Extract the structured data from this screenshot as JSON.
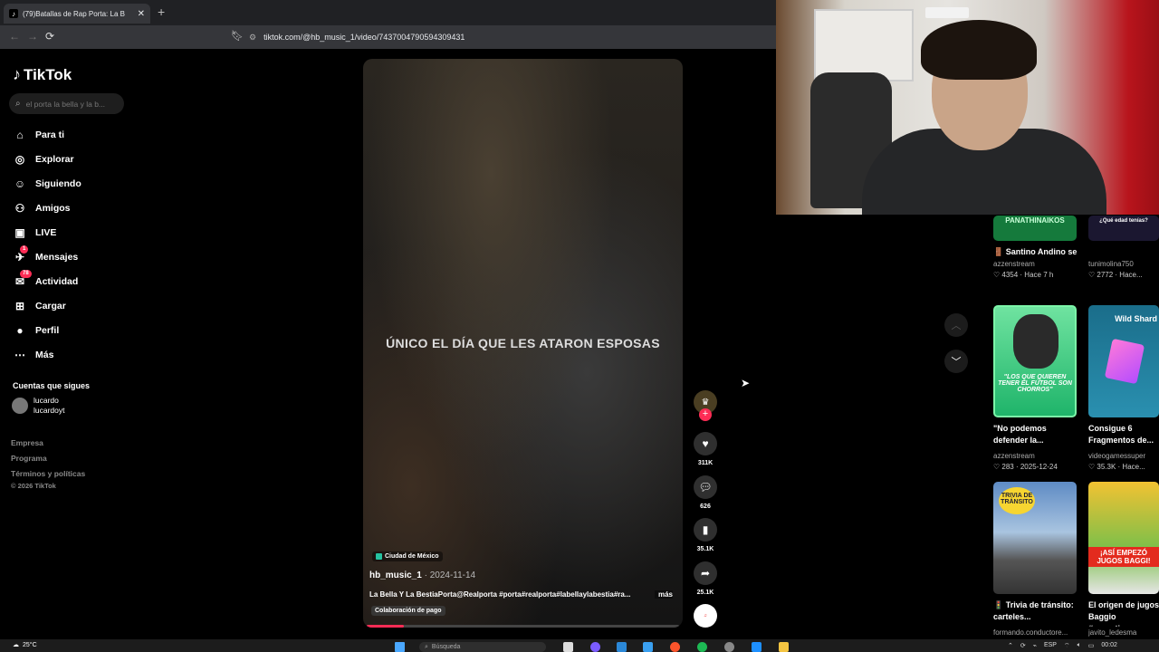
{
  "browser": {
    "tab_title": "(79)Batallas de Rap Porta: La B",
    "url": "tiktok.com/@hb_music_1/video/7437004790594309431"
  },
  "sidebar": {
    "logo": "TikTok",
    "search_placeholder": "el porta la bella y la b...",
    "nav": [
      {
        "label": "Para ti",
        "icon": "home-icon"
      },
      {
        "label": "Explorar",
        "icon": "compass-icon"
      },
      {
        "label": "Siguiendo",
        "icon": "following-icon"
      },
      {
        "label": "Amigos",
        "icon": "friends-icon"
      },
      {
        "label": "LIVE",
        "icon": "live-icon"
      },
      {
        "label": "Mensajes",
        "icon": "messages-icon",
        "badge": "1"
      },
      {
        "label": "Actividad",
        "icon": "activity-icon",
        "badge": "78"
      },
      {
        "label": "Cargar",
        "icon": "upload-icon"
      },
      {
        "label": "Perfil",
        "icon": "profile-icon"
      },
      {
        "label": "Más",
        "icon": "more-icon"
      }
    ],
    "following_title": "Cuentas que sigues",
    "following_user": {
      "name": "lucardo",
      "handle": "lucardoyt"
    },
    "footer": [
      "Empresa",
      "Programa",
      "Términos y políticas"
    ],
    "copyright": "© 2026 TikTok"
  },
  "video": {
    "overlay_text": "ÚNICO EL DÍA QUE LES ATARON ESPOSAS",
    "location": "Ciudad de México",
    "author": "hb_music_1",
    "date": " · 2024-11-14",
    "description": "La Bella Y La BestiaPorta@Realporta #porta#realporta#labellaylabestia#ra...",
    "more": "más",
    "paid_label": "Colaboración de pago",
    "progress": 0.12
  },
  "actions": {
    "likes": "311K",
    "comments": "626",
    "saves": "35.1K",
    "shares": "25.1K"
  },
  "recommendations": [
    {
      "banner": "PANATHINAIKOS",
      "title": "🚪 Santino Andino será vendido al...",
      "author": "azzenstream",
      "meta": "♡ 4354 · Hace 7 h"
    },
    {
      "banner": "¿Qué edad tenías?",
      "title": "",
      "author": "tunimolina750",
      "meta": "♡ 2772 · Hace..."
    },
    {
      "banner": "\"LOS QUE QUIEREN TENER EL FÚTBOL SON CHORROS\"",
      "title": "\"No podemos defender la...",
      "author": "azzenstream",
      "meta": "♡ 283 · 2025-12-24"
    },
    {
      "banner": "Wild Shard",
      "title": "Consigue 6 Fragmentos de...",
      "author": "videogamessuper",
      "meta": "♡ 35.3K · Hace..."
    },
    {
      "banner": "TRIVIA DE TRÁNSITO",
      "title": "🚦 Trivia de tránsito: carteles...",
      "author": "formando.conductore...",
      "meta": ""
    },
    {
      "banner": "¡ASÍ EMPEZÓ JUGOS BAGGI!",
      "title": "El origen de jugos Baggio #argentin...",
      "author": "javito_ledesma",
      "meta": ""
    }
  ],
  "taskbar": {
    "weather": "25°C",
    "search_placeholder": "Búsqueda",
    "language": "ESP",
    "time": "00:02"
  }
}
